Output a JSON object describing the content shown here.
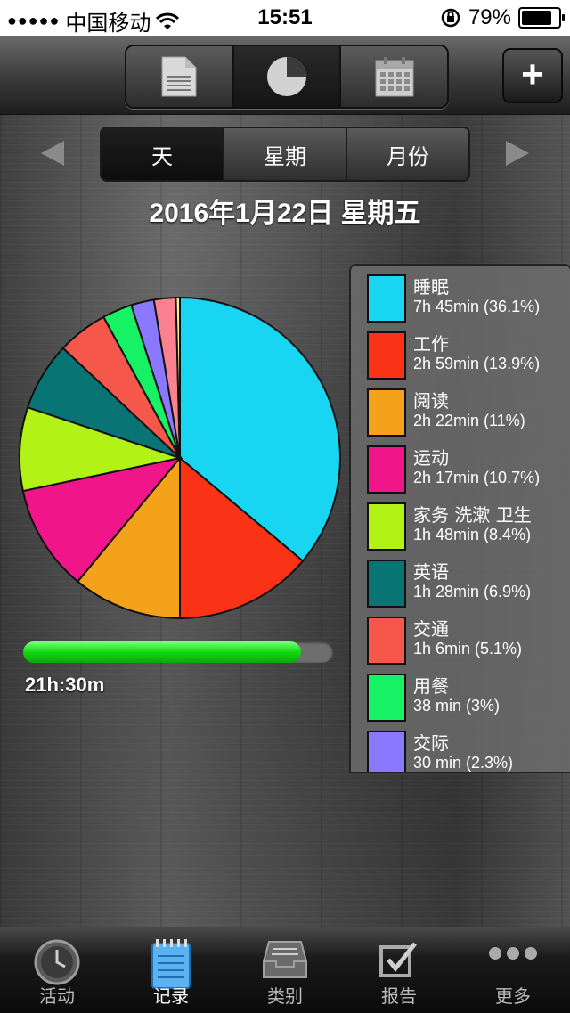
{
  "status_bar": {
    "carrier": "中国移动",
    "time": "15:51",
    "battery": "79%"
  },
  "toolbar": {
    "views": [
      {
        "icon": "document-icon"
      },
      {
        "icon": "pie-chart-icon"
      },
      {
        "icon": "calendar-icon"
      }
    ],
    "add_label": "+"
  },
  "period": {
    "options": [
      "天",
      "星期",
      "月份"
    ],
    "selected": "天"
  },
  "date_title": "2016年1月22日 星期五",
  "total": {
    "label": "21h:30m",
    "progress_percent": 89.6
  },
  "legend": [
    {
      "name": "睡眠",
      "value": "7h 45min (36.1%)",
      "color": "#18D6F2"
    },
    {
      "name": "工作",
      "value": "2h 59min (13.9%)",
      "color": "#FA3216"
    },
    {
      "name": "阅读",
      "value": "2h 22min (11%)",
      "color": "#F5A21B"
    },
    {
      "name": "运动",
      "value": "2h 17min (10.7%)",
      "color": "#F0168A"
    },
    {
      "name": "家务 洗漱 卫生",
      "value": "1h 48min (8.4%)",
      "color": "#B3F216"
    },
    {
      "name": "英语",
      "value": "1h 28min (6.9%)",
      "color": "#087474"
    },
    {
      "name": "交通",
      "value": "1h 6min (5.1%)",
      "color": "#F5584A"
    },
    {
      "name": "用餐",
      "value": "38 min (3%)",
      "color": "#16F263"
    },
    {
      "name": "交际",
      "value": "30 min (2.3%)",
      "color": "#8A78FF"
    }
  ],
  "chart_data": {
    "type": "pie",
    "categories": [
      "睡眠",
      "工作",
      "阅读",
      "运动",
      "家务 洗漱 卫生",
      "英语",
      "交通",
      "用餐",
      "交际",
      "",
      ""
    ],
    "values": [
      36.1,
      13.9,
      11,
      10.7,
      8.4,
      6.9,
      5.1,
      3,
      2.3,
      2.2,
      0.4
    ],
    "colors": [
      "#18D6F2",
      "#FA3216",
      "#F5A21B",
      "#F0168A",
      "#B3F216",
      "#087474",
      "#F5584A",
      "#16F263",
      "#8A78FF",
      "#FA8290",
      "#F2EE9A"
    ]
  },
  "tabbar": {
    "tabs": [
      {
        "label": "活动",
        "icon": "clock-icon"
      },
      {
        "label": "记录",
        "icon": "notepad-icon"
      },
      {
        "label": "类别",
        "icon": "inbox-tray-icon"
      },
      {
        "label": "报告",
        "icon": "checkbox-icon"
      },
      {
        "label": "更多",
        "icon": "more-dots-icon"
      }
    ],
    "active": "记录"
  }
}
